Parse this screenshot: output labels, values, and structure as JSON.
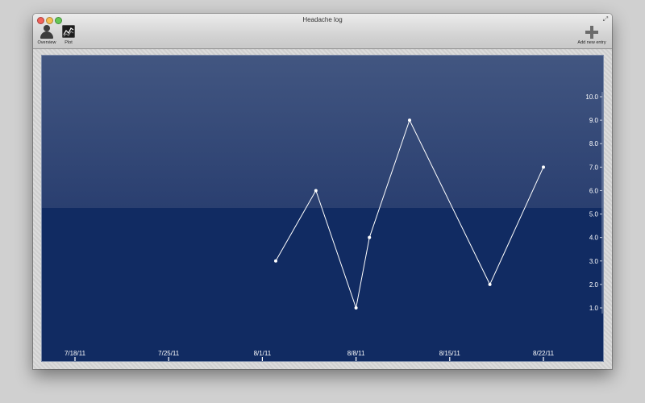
{
  "window": {
    "title": "Headache log",
    "fullscreen_icon": "fullscreen-arrows-icon"
  },
  "toolbar": {
    "overview_label": "Overview",
    "overview_icon": "person-icon",
    "plot_label": "Plot",
    "plot_icon": "line-chart-icon",
    "add_label": "Add new entry",
    "add_icon": "plus-icon"
  },
  "colors": {
    "plot_background": "#112b62",
    "plot_highlight": "#425681",
    "line": "#ffffff",
    "text": "#ffffff"
  },
  "chart_data": {
    "type": "line",
    "title": "",
    "xlabel": "",
    "ylabel": "",
    "x_ticks": [
      "7/18/11",
      "7/25/11",
      "8/1/11",
      "8/8/11",
      "8/15/11",
      "8/22/11"
    ],
    "y_ticks": [
      "1.0",
      "2.0",
      "3.0",
      "4.0",
      "5.0",
      "6.0",
      "7.0",
      "8.0",
      "9.0",
      "10.0"
    ],
    "xlim": [
      "2011-07-18",
      "2011-08-22"
    ],
    "ylim": [
      1,
      10
    ],
    "grid": false,
    "x": [
      "2011-08-02",
      "2011-08-05",
      "2011-08-08",
      "2011-08-09",
      "2011-08-12",
      "2011-08-18",
      "2011-08-22"
    ],
    "y": [
      3,
      6,
      1,
      4,
      9,
      2,
      7
    ]
  }
}
